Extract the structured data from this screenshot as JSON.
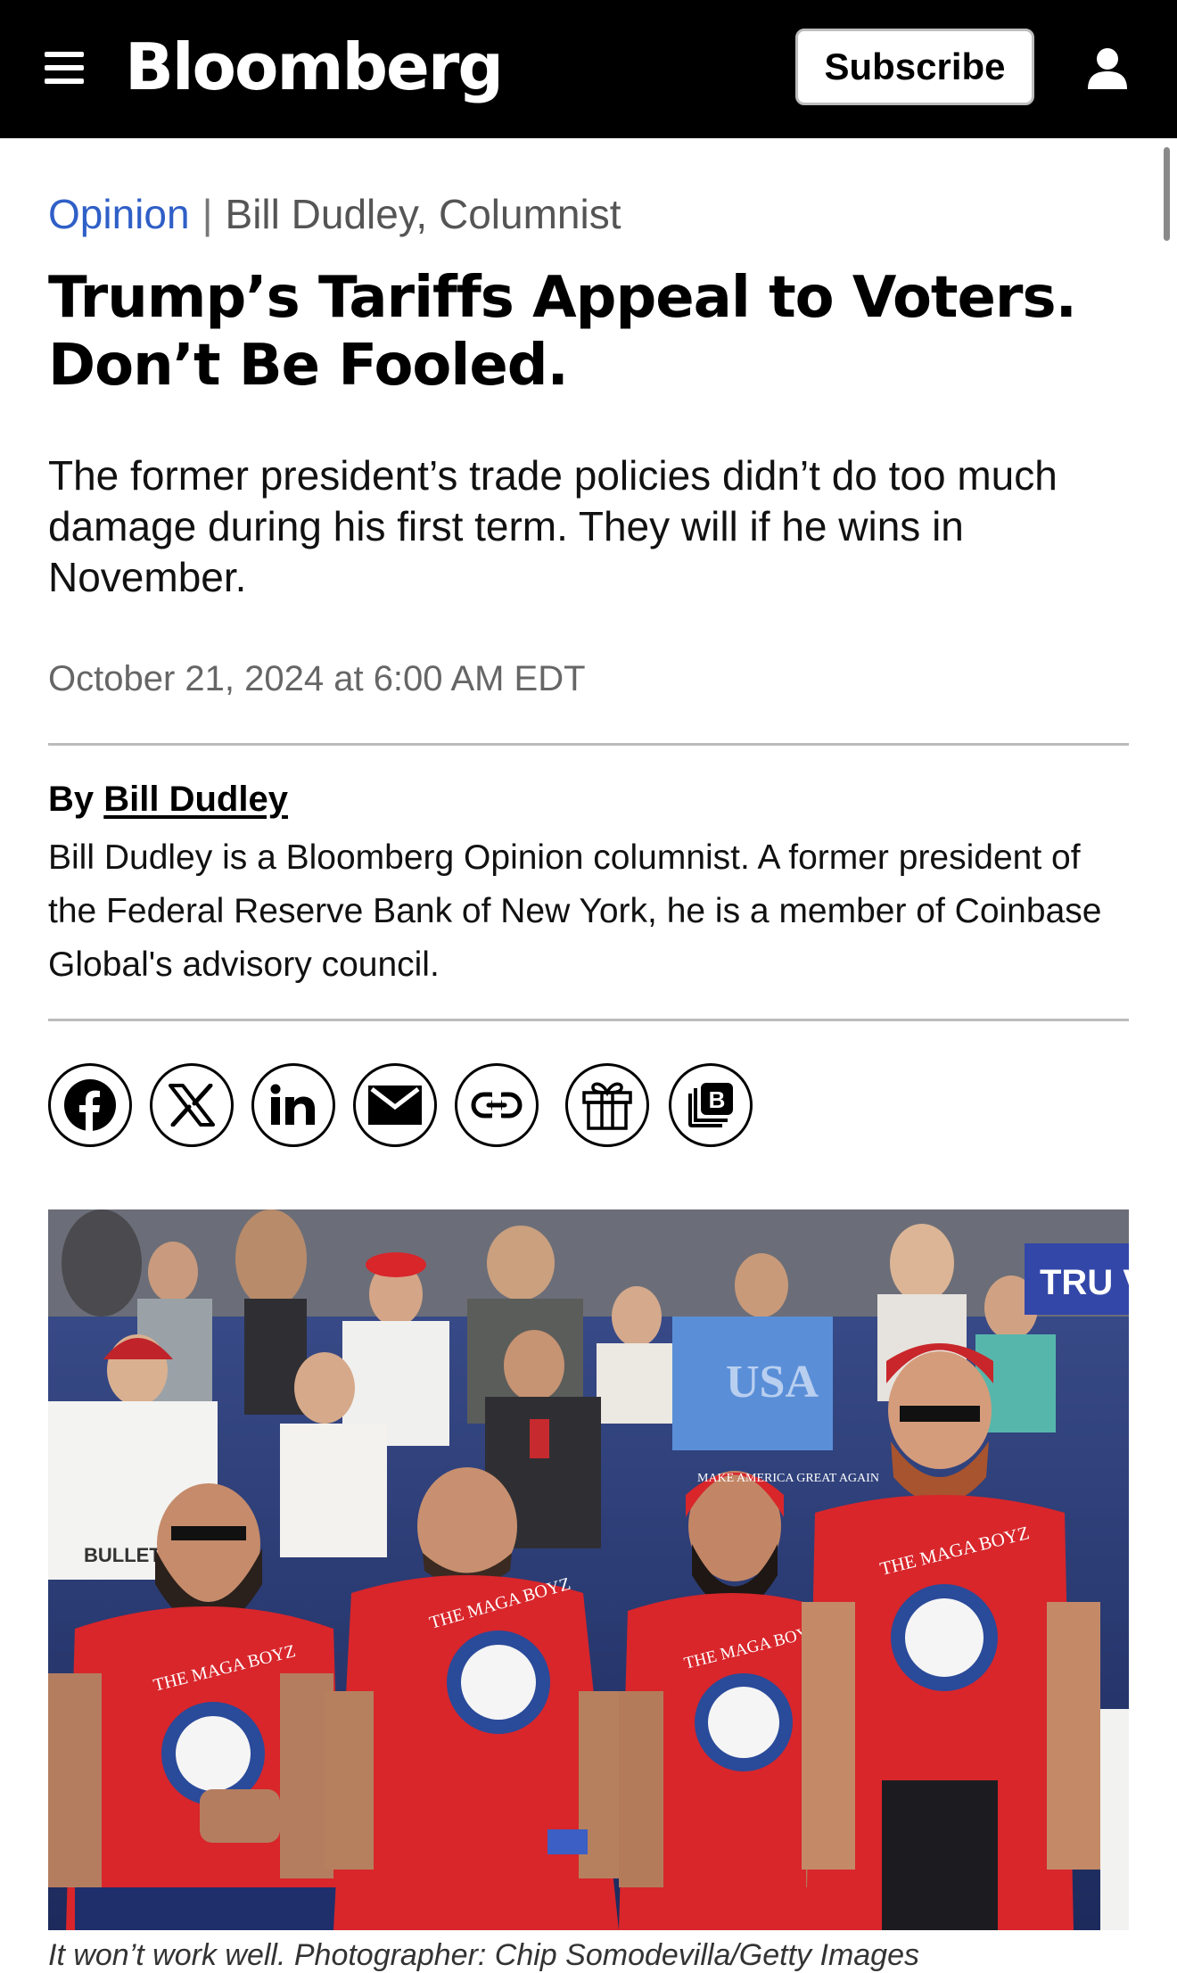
{
  "header": {
    "logo": "Bloomberg",
    "subscribe_label": "Subscribe"
  },
  "article": {
    "section": "Opinion",
    "separator": "|",
    "author_tag": "Bill Dudley, Columnist",
    "headline": "Trump’s Tariffs Appeal to Voters. Don’t Be Fooled.",
    "dek": "The former president’s trade policies didn’t do too much damage during his first term. They will if he wins in November.",
    "date": "October 21, 2024 at 6:00 AM EDT",
    "byline_prefix": "By",
    "byline_name": "Bill Dudley",
    "bio": "Bill Dudley is a Bloomberg Opinion columnist. A former president of the Federal Reserve Bank of New York, he is a member of Coinbase Global's advisory council.",
    "share": [
      "facebook",
      "x",
      "linkedin",
      "email",
      "copy-link",
      "gift",
      "bloomberg-terminal"
    ],
    "photo": {
      "alt": "Rally attendees in red \"The Maga Boyz\" shirts standing in the crowd",
      "shirt_text": "THE MAGA BOYZ",
      "hat_text": "MAKE AMERICA GREAT AGAIN",
      "sign_text": "TRU VAN",
      "bullet_text": "BULLET PROO",
      "tshirt_text": "USA",
      "caption": "It won’t work well. Photographer: Chip Somodevilla/Getty Images"
    }
  },
  "colors": {
    "topbar": "#000000",
    "section_link": "#2f5fc7",
    "rally_red": "#d8262b"
  }
}
